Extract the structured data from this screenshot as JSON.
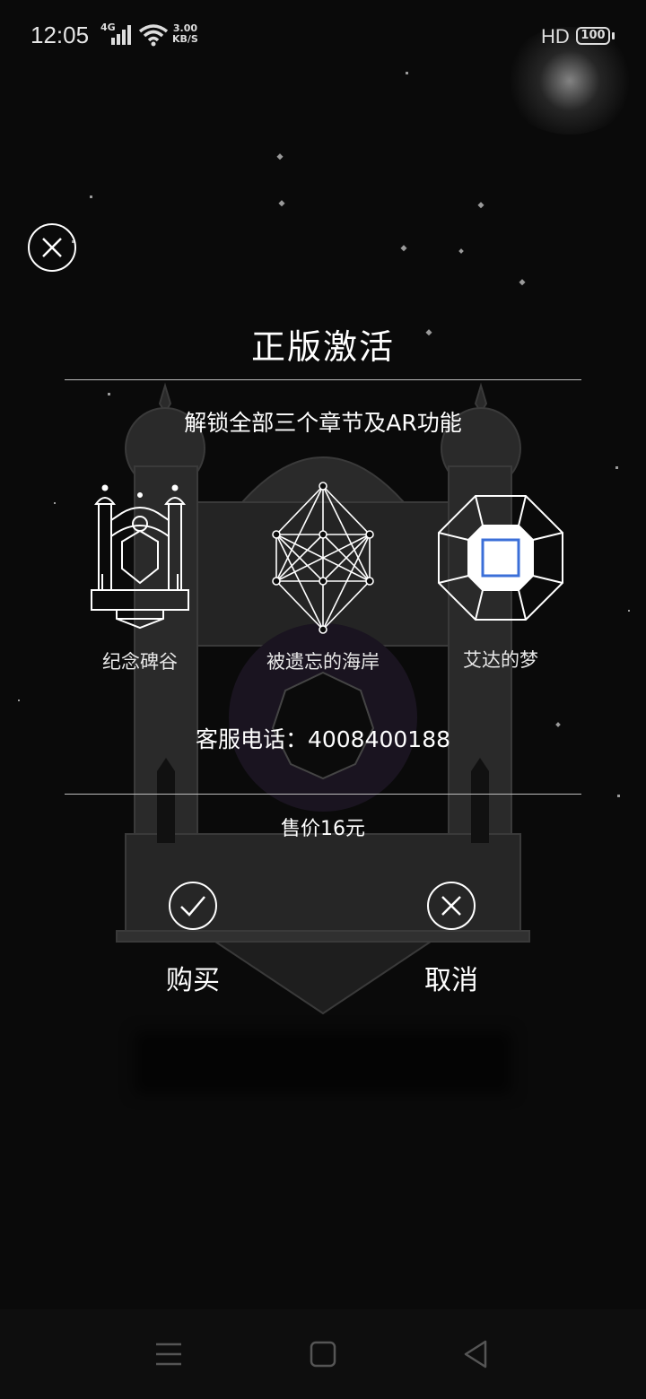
{
  "status_bar": {
    "time": "12:05",
    "network": "4G",
    "speed_value": "3.00",
    "speed_unit": "KB/S",
    "hd": "HD",
    "battery": "100"
  },
  "dialog": {
    "title": "正版激活",
    "subtitle": "解锁全部三个章节及AR功能",
    "chapters": [
      {
        "label": "纪念碑谷",
        "icon": "palace-icon"
      },
      {
        "label": "被遗忘的海岸",
        "icon": "geometric-crystal-icon"
      },
      {
        "label": "艾达的梦",
        "icon": "octagon-gem-icon"
      }
    ],
    "phone": "客服电话：4008400188",
    "price": "售价16元",
    "buy_label": "购买",
    "cancel_label": "取消"
  },
  "colors": {
    "background": "#0a0a0a",
    "text": "#ffffff",
    "gem_blue": "#3b6fd8"
  }
}
